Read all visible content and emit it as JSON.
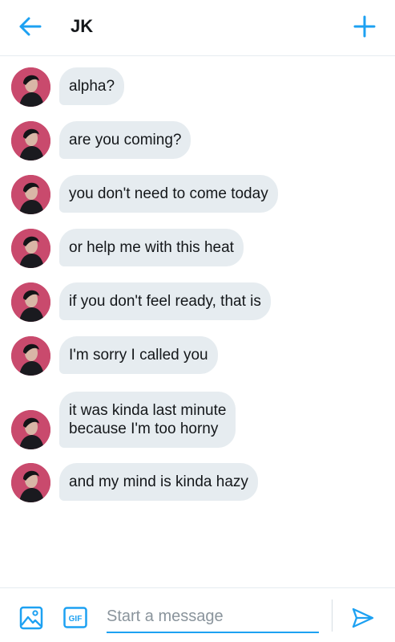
{
  "header": {
    "back_icon": "arrow-left-icon",
    "title": "JK",
    "new_icon": "plus-icon",
    "accent_color": "#1da1f2"
  },
  "messages": [
    {
      "lines": [
        "alpha?"
      ]
    },
    {
      "lines": [
        "are you coming?"
      ]
    },
    {
      "lines": [
        "you don't need to come today"
      ]
    },
    {
      "lines": [
        "or help me with this heat"
      ]
    },
    {
      "lines": [
        "if you don't feel ready, that is"
      ]
    },
    {
      "lines": [
        "I'm sorry I called you"
      ]
    },
    {
      "lines": [
        "it was kinda last minute",
        "because I'm too horny"
      ]
    },
    {
      "lines": [
        "and my mind is kinda hazy"
      ]
    }
  ],
  "colors": {
    "bubble": "#e6ecf0",
    "avatar_bg": "#c94a6d"
  },
  "composer": {
    "media_icon": "image-icon",
    "gif_icon": "gif-icon",
    "gif_label": "GIF",
    "placeholder": "Start a message",
    "send_icon": "send-icon"
  }
}
